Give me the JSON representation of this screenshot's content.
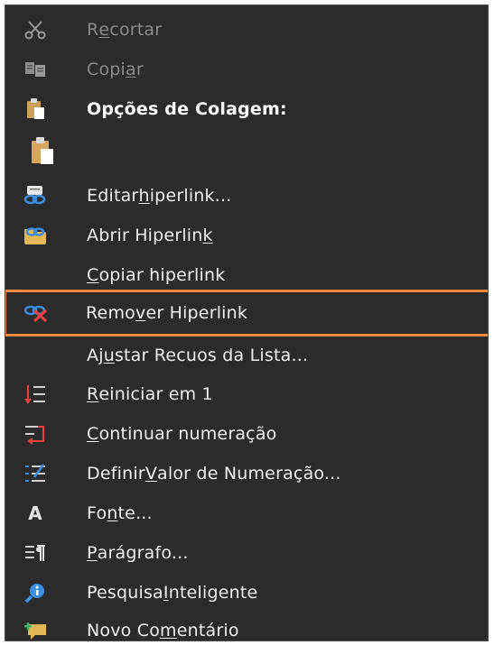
{
  "colors": {
    "menu_bg": "#2b2b2b",
    "text": "#f0f0f0",
    "disabled_text": "#8a8a8a",
    "highlight_border": "#f5883a"
  },
  "menu": {
    "items": [
      {
        "label_pre": "R",
        "label_u": "e",
        "label_post": "cortar",
        "icon": "scissors-icon",
        "state": "disabled"
      },
      {
        "label_pre": "Copi",
        "label_u": "a",
        "label_post": "r",
        "icon": "copy-icon",
        "state": "disabled"
      },
      {
        "label": "Opções de Colagem:",
        "icon": "clipboard-icon",
        "state": "header"
      },
      {
        "label": "",
        "icon": "paste-icon",
        "state": "paste-option"
      },
      {
        "label_pre": "Editar ",
        "label_u": "h",
        "label_post": "iperlink...",
        "icon": "edit-link-icon"
      },
      {
        "label_pre": "Abrir Hiperlin",
        "label_u": "k",
        "label_post": "",
        "icon": "open-link-icon"
      },
      {
        "label_pre": "",
        "label_u": "C",
        "label_post": "opiar hiperlink",
        "icon": "none"
      },
      {
        "label_pre": "Remo",
        "label_u": "v",
        "label_post": "er Hiperlink",
        "icon": "remove-link-icon",
        "state": "highlighted"
      },
      {
        "label_pre": "Aj",
        "label_u": "u",
        "label_post": "star Recuos da Lista...",
        "icon": "none"
      },
      {
        "label_pre": "",
        "label_u": "R",
        "label_post": "einiciar em 1",
        "icon": "restart-numbering-icon"
      },
      {
        "label_pre": "",
        "label_u": "C",
        "label_post": "ontinuar numeração",
        "icon": "continue-numbering-icon"
      },
      {
        "label_pre": "Definir ",
        "label_u": "V",
        "label_post": "alor de Numeração...",
        "icon": "set-numbering-value-icon"
      },
      {
        "label_pre": "Fo",
        "label_u": "n",
        "label_post": "te...",
        "icon": "font-icon",
        "icon_text": "A"
      },
      {
        "label_pre": "",
        "label_u": "P",
        "label_post": "arágrafo...",
        "icon": "paragraph-icon"
      },
      {
        "label_pre": "Pesquisa ",
        "label_u": "I",
        "label_post": "nteligente",
        "icon": "smart-lookup-icon"
      },
      {
        "label_pre": "Novo Co",
        "label_u": "m",
        "label_post": "entário",
        "icon": "new-comment-icon"
      }
    ]
  }
}
